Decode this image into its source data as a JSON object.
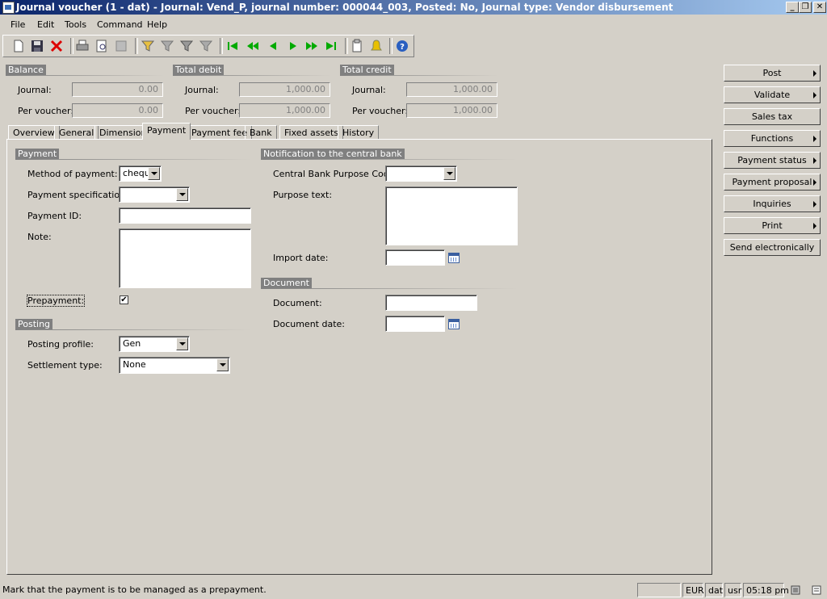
{
  "window": {
    "title": "Journal voucher (1 - dat) - Journal: Vend_P, journal number: 000044_003, Posted: No, Journal type: Vendor disbursement",
    "minimize": "_",
    "maximize": "❐",
    "close": "✕"
  },
  "menu": [
    "File",
    "Edit",
    "Tools",
    "Command",
    "Help"
  ],
  "toolbar": {
    "icons": [
      "new-icon",
      "save-icon",
      "delete-icon",
      "print-icon",
      "print-preview-icon",
      "print-setup-icon",
      "filter-by-selection-icon",
      "filter-by-grid-icon",
      "advanced-filter-icon",
      "remove-filter-icon",
      "first-record-icon",
      "previous-page-icon",
      "previous-record-icon",
      "next-record-icon",
      "next-page-icon",
      "last-record-icon",
      "document-handling-icon",
      "alert-icon",
      "help-icon"
    ]
  },
  "balance": {
    "header": "Balance",
    "journal_label": "Journal:",
    "journal_value": "0.00",
    "voucher_label": "Per voucher:",
    "voucher_value": "0.00"
  },
  "total_debit": {
    "header": "Total debit",
    "journal_label": "Journal:",
    "journal_value": "1,000.00",
    "voucher_label": "Per voucher:",
    "voucher_value": "1,000.00"
  },
  "total_credit": {
    "header": "Total credit",
    "journal_label": "Journal:",
    "journal_value": "1,000.00",
    "voucher_label": "Per voucher:",
    "voucher_value": "1,000.00"
  },
  "tabs": [
    "Overview",
    "General",
    "Dimension",
    "Payment",
    "Payment fee",
    "Bank",
    "Fixed assets",
    "History"
  ],
  "active_tab": "Payment",
  "payment": {
    "header": "Payment",
    "method_label": "Method of payment:",
    "method_value": "chequ",
    "spec_label": "Payment specification:",
    "spec_value": "",
    "id_label": "Payment ID:",
    "id_value": "",
    "note_label": "Note:",
    "note_value": "",
    "prepayment_label": "Prepayment:",
    "prepayment_checked": "✔"
  },
  "posting": {
    "header": "Posting",
    "profile_label": "Posting profile:",
    "profile_value": "Gen",
    "settlement_label": "Settlement type:",
    "settlement_value": "None"
  },
  "notification": {
    "header": "Notification to the central bank",
    "purpose_code_label": "Central Bank Purpose Code:",
    "purpose_code_value": "",
    "purpose_text_label": "Purpose text:",
    "purpose_text_value": "",
    "import_date_label": "Import date:",
    "import_date_value": ""
  },
  "document": {
    "header": "Document",
    "document_label": "Document:",
    "document_value": "",
    "date_label": "Document date:",
    "date_value": ""
  },
  "actions": [
    {
      "label": "Post",
      "submenu": true
    },
    {
      "label": "Validate",
      "submenu": true
    },
    {
      "label": "Sales tax",
      "submenu": false
    },
    {
      "label": "Functions",
      "submenu": true
    },
    {
      "label": "Payment status",
      "submenu": true
    },
    {
      "label": "Payment proposal",
      "submenu": true
    },
    {
      "label": "Inquiries",
      "submenu": true
    },
    {
      "label": "Print",
      "submenu": true
    },
    {
      "label": "Send electronically",
      "submenu": false
    }
  ],
  "status": {
    "message": "Mark that the payment is to be managed as a prepayment.",
    "currency": "EUR",
    "company": "dat",
    "user": "usr",
    "time": "05:18 pm"
  },
  "colors": {
    "window_bg": "#d4d0c8",
    "titlebar_start": "#0a246a",
    "titlebar_end": "#a6caf0",
    "group_header": "#808080"
  }
}
